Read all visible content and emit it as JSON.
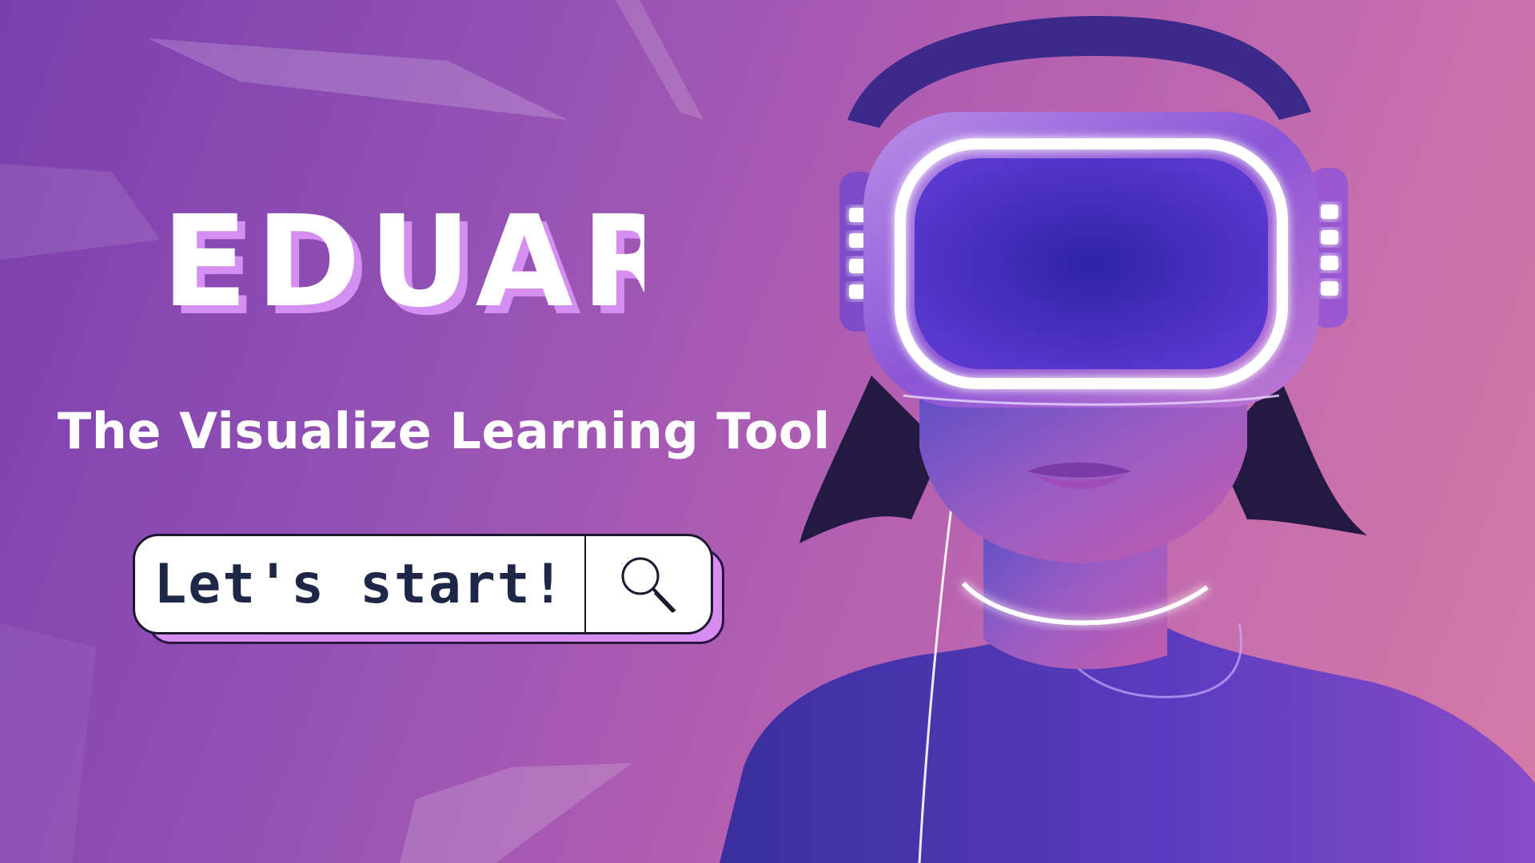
{
  "brand": {
    "title": "EDUAR"
  },
  "hero": {
    "subtitle": "The Visualize Learning Tool"
  },
  "search": {
    "label": "Let's start!",
    "icon": "magnifier-icon"
  },
  "colors": {
    "background_left": "#7a3fae",
    "background_right": "#d67aa8",
    "title_shadow": "#d48ff0",
    "search_text": "#1e2748",
    "visor_glow": "#f2e6ff"
  }
}
